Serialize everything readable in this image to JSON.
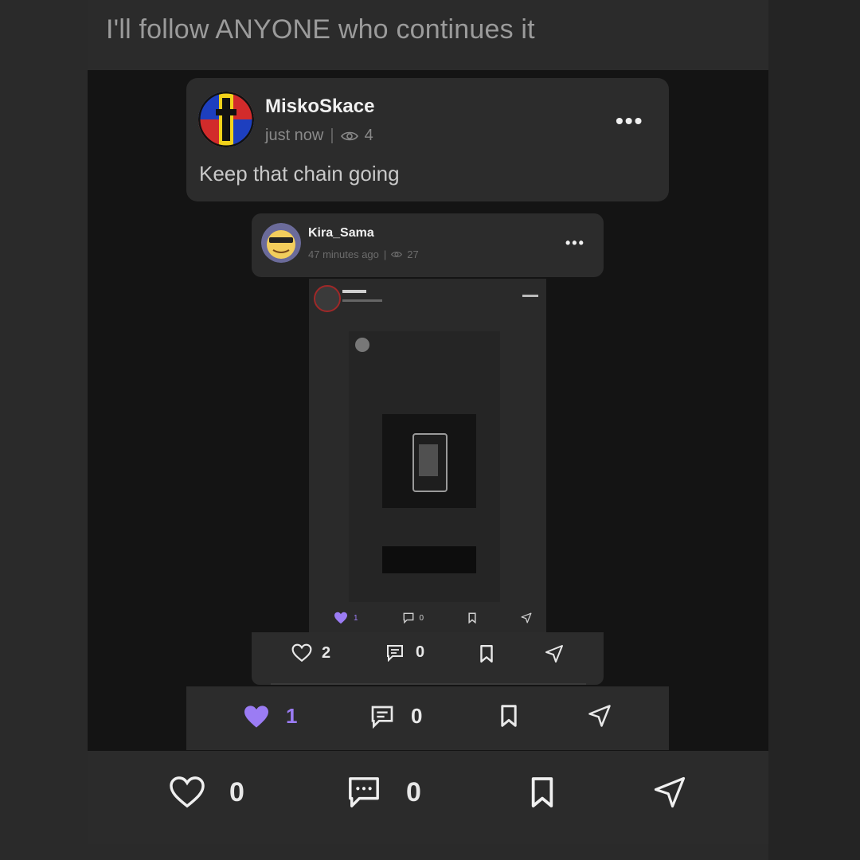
{
  "caption": "I'll follow ANYONE who continues it",
  "post_l1": {
    "username": "MiskoSkace",
    "time": "just now",
    "views": "4",
    "text": "Keep that chain going",
    "likes": "1",
    "comments": "0"
  },
  "post_l2": {
    "username": "Kira_Sama",
    "time": "47 minutes ago",
    "views": "27",
    "likes": "2",
    "comments": "0"
  },
  "post_l3": {
    "likes": "1",
    "comments": "0"
  },
  "outer_actions": {
    "likes": "0",
    "comments": "0"
  },
  "colors": {
    "accent": "#9b7cf4",
    "background": "#2a2a2a",
    "media_background": "#141414",
    "card": "#2c2c2c"
  }
}
